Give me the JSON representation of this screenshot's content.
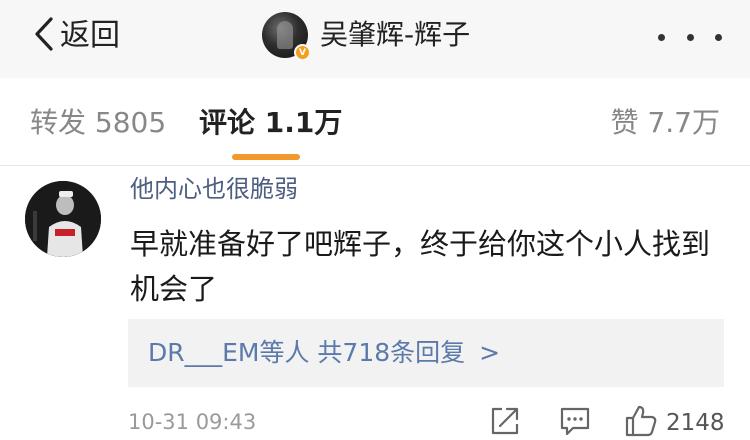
{
  "nav": {
    "back_label": "返回",
    "title": "吴肇辉-辉子",
    "verified_badge": "V",
    "icons": {
      "back": "chevron-left-icon",
      "more": "more-dots-icon"
    }
  },
  "tabs": {
    "repost": "转发 5805",
    "comment": "评论 1.1万",
    "like": "赞 7.7万",
    "active": "comment",
    "accent_color": "#f19a2b"
  },
  "comment": {
    "username": "他内心也很脆弱",
    "content": "早就准备好了吧辉子，终于给你这个小人找到机会了",
    "replies": {
      "summary": "DR___EM等人 共718条回复",
      "arrow": ">"
    },
    "time": "10-31 09:43",
    "like_count": "2148",
    "icons": {
      "share": "share-icon",
      "reply": "comment-icon",
      "like": "thumbs-up-icon"
    }
  },
  "colors": {
    "username": "#4d5e80",
    "reply_link": "#5b7aaa",
    "nav_bg": "#f7f7f7",
    "reply_bg": "#f2f2f2"
  }
}
